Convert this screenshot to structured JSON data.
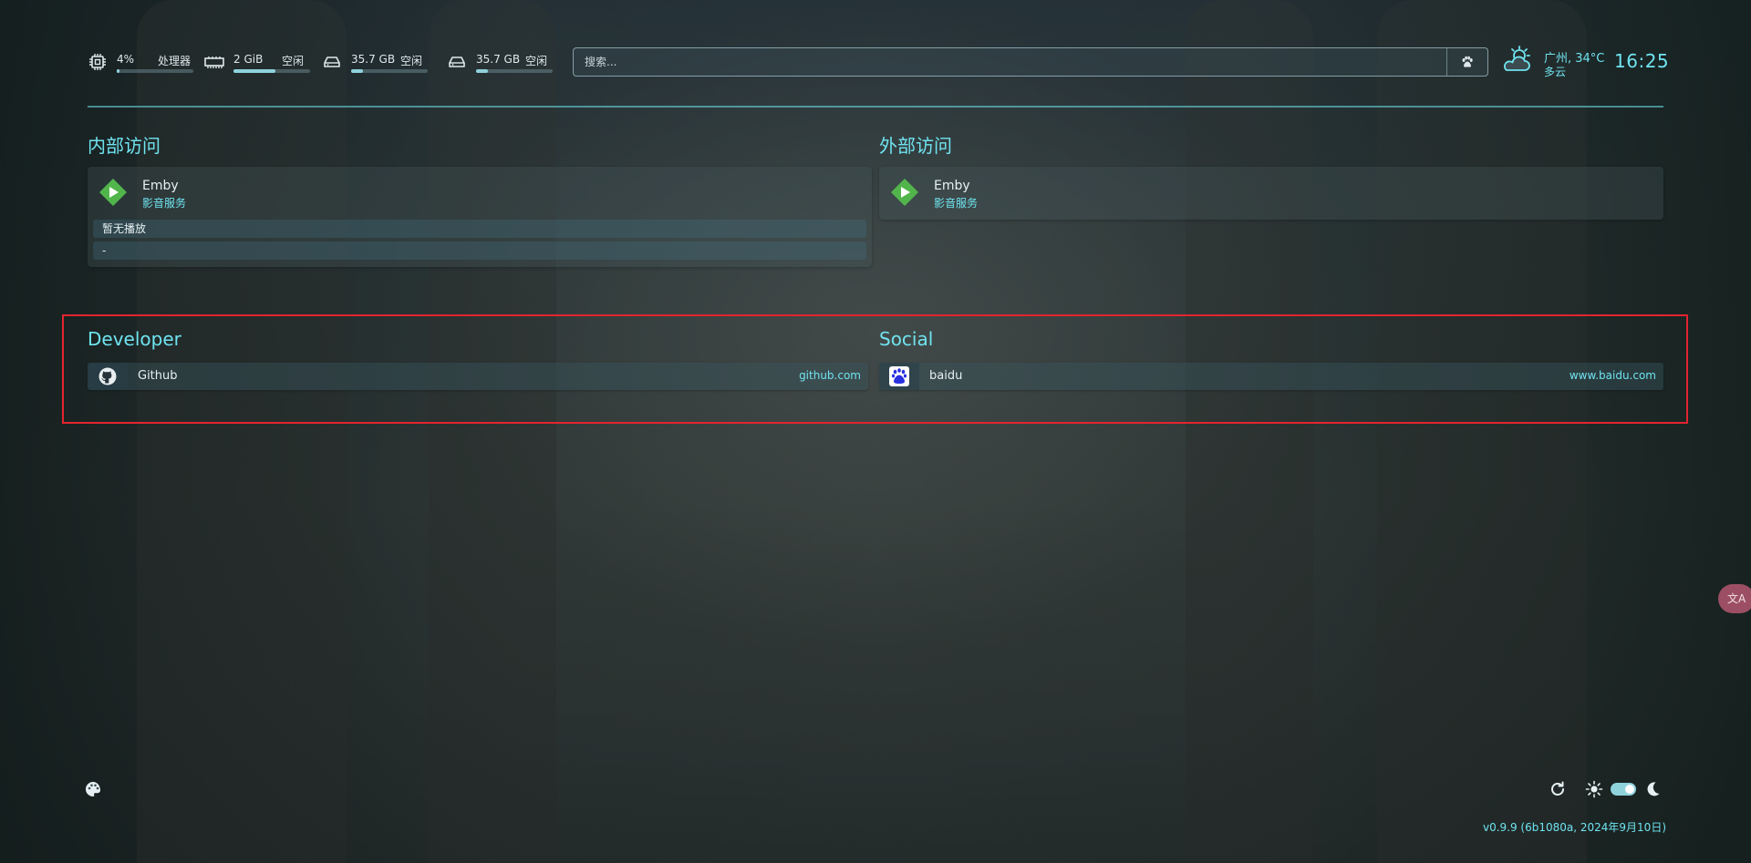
{
  "resources": {
    "cpu": {
      "value": "4%",
      "label": "处理器",
      "percent": 4
    },
    "memory": {
      "value": "2 GiB",
      "label": "空闲",
      "percent": 55
    },
    "disk1": {
      "value": "35.7 GB",
      "label": "空闲",
      "percent": 15
    },
    "disk2": {
      "value": "35.7 GB",
      "label": "空闲",
      "percent": 15
    }
  },
  "search": {
    "placeholder": "搜索..."
  },
  "weather": {
    "location": "广州, 34°C",
    "condition": "多云"
  },
  "clock": {
    "time": "16:25"
  },
  "services": [
    {
      "title": "内部访问",
      "items": [
        {
          "name": "Emby",
          "description": "影音服务",
          "widget": {
            "status": "暂无播放",
            "detail": "-"
          }
        }
      ]
    },
    {
      "title": "外部访问",
      "items": [
        {
          "name": "Emby",
          "description": "影音服务"
        }
      ]
    }
  ],
  "bookmarks": [
    {
      "title": "Developer",
      "items": [
        {
          "name": "Github",
          "url": "github.com",
          "icon": "github-icon"
        }
      ]
    },
    {
      "title": "Social",
      "items": [
        {
          "name": "baidu",
          "url": "www.baidu.com",
          "icon": "baidu-icon"
        }
      ]
    }
  ],
  "footer": {
    "version": "v0.9.9 (6b1080a, 2024年9月10日)",
    "theme_toggle_on": true
  },
  "translate": {
    "label": "文A"
  },
  "colors": {
    "accent": "#6fe3ef",
    "highlight_border": "#e3242f",
    "translate_button": "#9c4f64"
  }
}
